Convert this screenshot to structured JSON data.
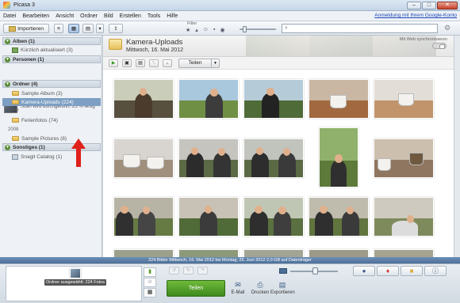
{
  "window": {
    "title": "Picasa 3",
    "minimize": "–",
    "maximize": "□",
    "close": "✕"
  },
  "menu": [
    "Datei",
    "Bearbeiten",
    "Ansicht",
    "Ordner",
    "Bild",
    "Erstellen",
    "Tools",
    "Hilfe"
  ],
  "account_link": "Anmeldung mit Ihrem Google-Konto",
  "toolbar": {
    "import_label": "Importieren",
    "filter_label": "Filter",
    "search_value": "",
    "gear_icon": "gear-icon"
  },
  "sidebar": {
    "sections": {
      "alben": "Alben (1)",
      "personen": "Personen (1)",
      "ordner": "Ordner (4)",
      "sonstiges": "Sonstiges (1)"
    },
    "alben_items": [
      "Kürzlich aktualisiert (3)"
    ],
    "scan_text": "Scan wird durchgeführt: 25 % fertig",
    "ordner_items": [
      {
        "label": "Sample Album (3)"
      },
      {
        "label": "Kamera-Uploads (224)"
      },
      {
        "year": "2009"
      },
      {
        "label": "Ferienfotos (74)"
      },
      {
        "year": "2008"
      },
      {
        "label": "Sample Pictures (8)"
      }
    ],
    "sonstiges_items": [
      "Snagit Catalog (1)"
    ]
  },
  "album": {
    "title": "Kamera-Uploads",
    "date": "Mittwoch, 16. Mai 2012",
    "sync_label": "Mit Web synchronisieren",
    "share_label": "Teilen"
  },
  "status_bar": "224 Bilder    Mittwoch, 16. Mai 2012 bis Montag, 25. Juni 2012    2,0 GB auf Datenträger",
  "bottom": {
    "tray_label": "Ordner ausgewählt: 224 Fotos",
    "share_button": "Teilen",
    "actions": [
      {
        "label": "E-Mail",
        "icon": "envelope-icon"
      },
      {
        "label": "Drucken",
        "icon": "printer-icon"
      },
      {
        "label": "Exportieren",
        "icon": "export-icon"
      }
    ]
  },
  "colors": {
    "selection": "#7d9fc3",
    "share_green": "#4e9c27",
    "status_blue": "#5a7ea8",
    "arrow_red": "#e0201a"
  }
}
